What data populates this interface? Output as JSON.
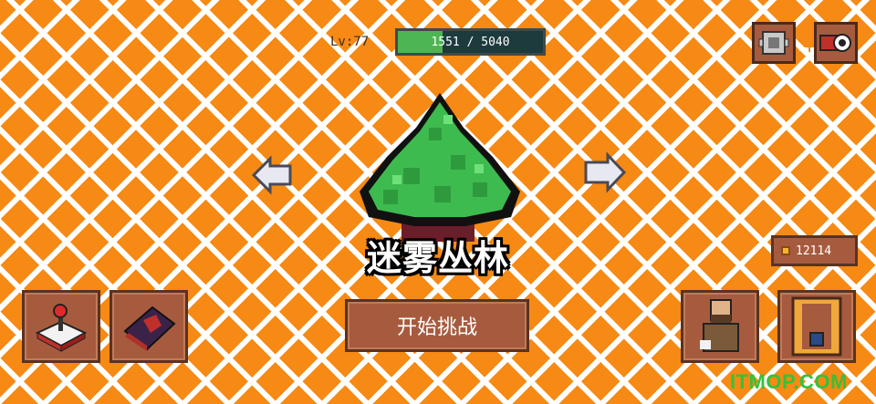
{
  "player": {
    "level_label": "Lv:77",
    "xp_current": 1551,
    "xp_max": 5040,
    "xp_text": "1551 / 5040"
  },
  "stage": {
    "name": "迷雾丛林"
  },
  "actions": {
    "start_label": "开始挑战"
  },
  "currency": {
    "amount": "12114"
  },
  "watermark": {
    "text": "ITMOP.COM"
  },
  "colors": {
    "background": "#f68a14",
    "grid": "#ffffff",
    "panel": "#a65b3f",
    "panel_border": "#5a3222",
    "xp_fill": "#4db551",
    "tree": "#3dbb4f"
  },
  "icons": {
    "top_right": [
      "gear-icon",
      "camera-icon"
    ],
    "bottom_left": [
      "joystick-icon",
      "spellbook-icon"
    ],
    "bottom_right": [
      "character-icon",
      "backpack-icon"
    ],
    "nav": [
      "arrow-left-icon",
      "arrow-right-icon"
    ]
  }
}
